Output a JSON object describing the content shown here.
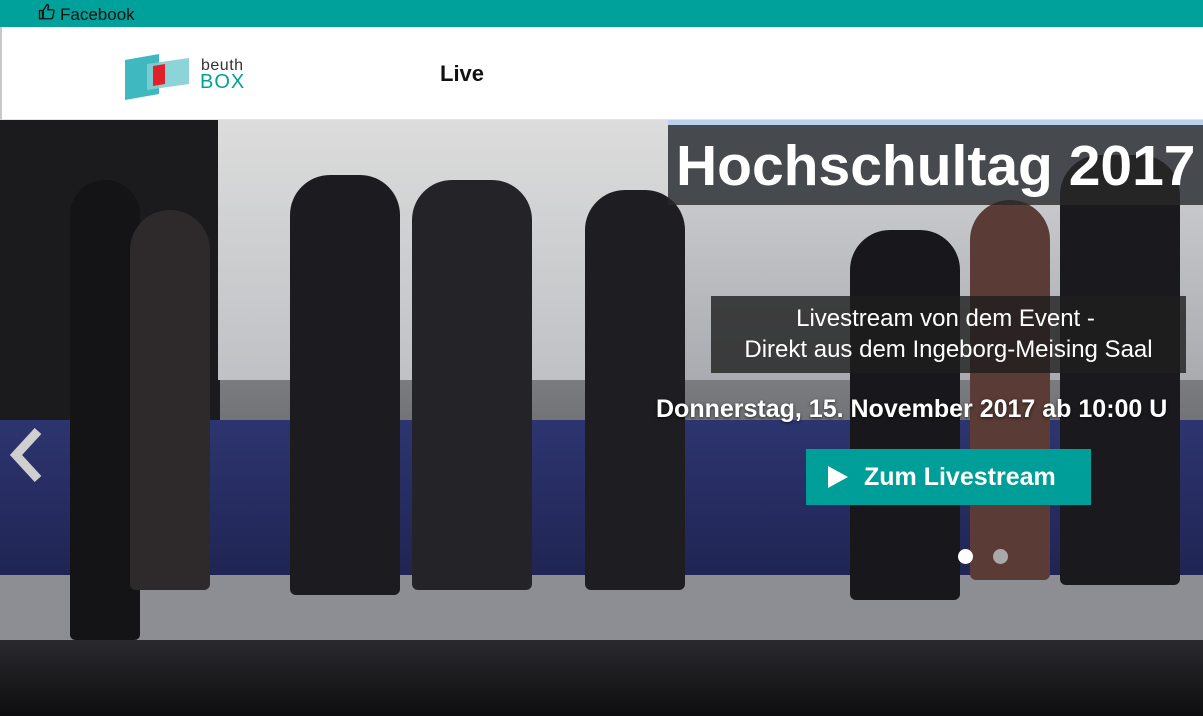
{
  "topbar": {
    "facebook_label": "Facebook",
    "icon": "thumbs-up-icon"
  },
  "header": {
    "logo": {
      "line1": "beuth",
      "line2": "BOX"
    },
    "nav": {
      "live_label": "Live"
    }
  },
  "hero": {
    "title": "Hochschultag 2017",
    "subtitle_line1": "Livestream von dem Event -",
    "subtitle_line2": "Direkt aus dem Ingeborg-Meising Saal",
    "date_text": "Donnerstag, 15. November 2017 ab 10:00 U",
    "cta_label": "Zum Livestream",
    "cta_icon": "play-icon",
    "prev_icon": "chevron-left-icon",
    "carousel": {
      "slide_count": 2,
      "active_index": 0
    }
  },
  "colors": {
    "accent": "#00a19a",
    "button": "#009e98"
  }
}
